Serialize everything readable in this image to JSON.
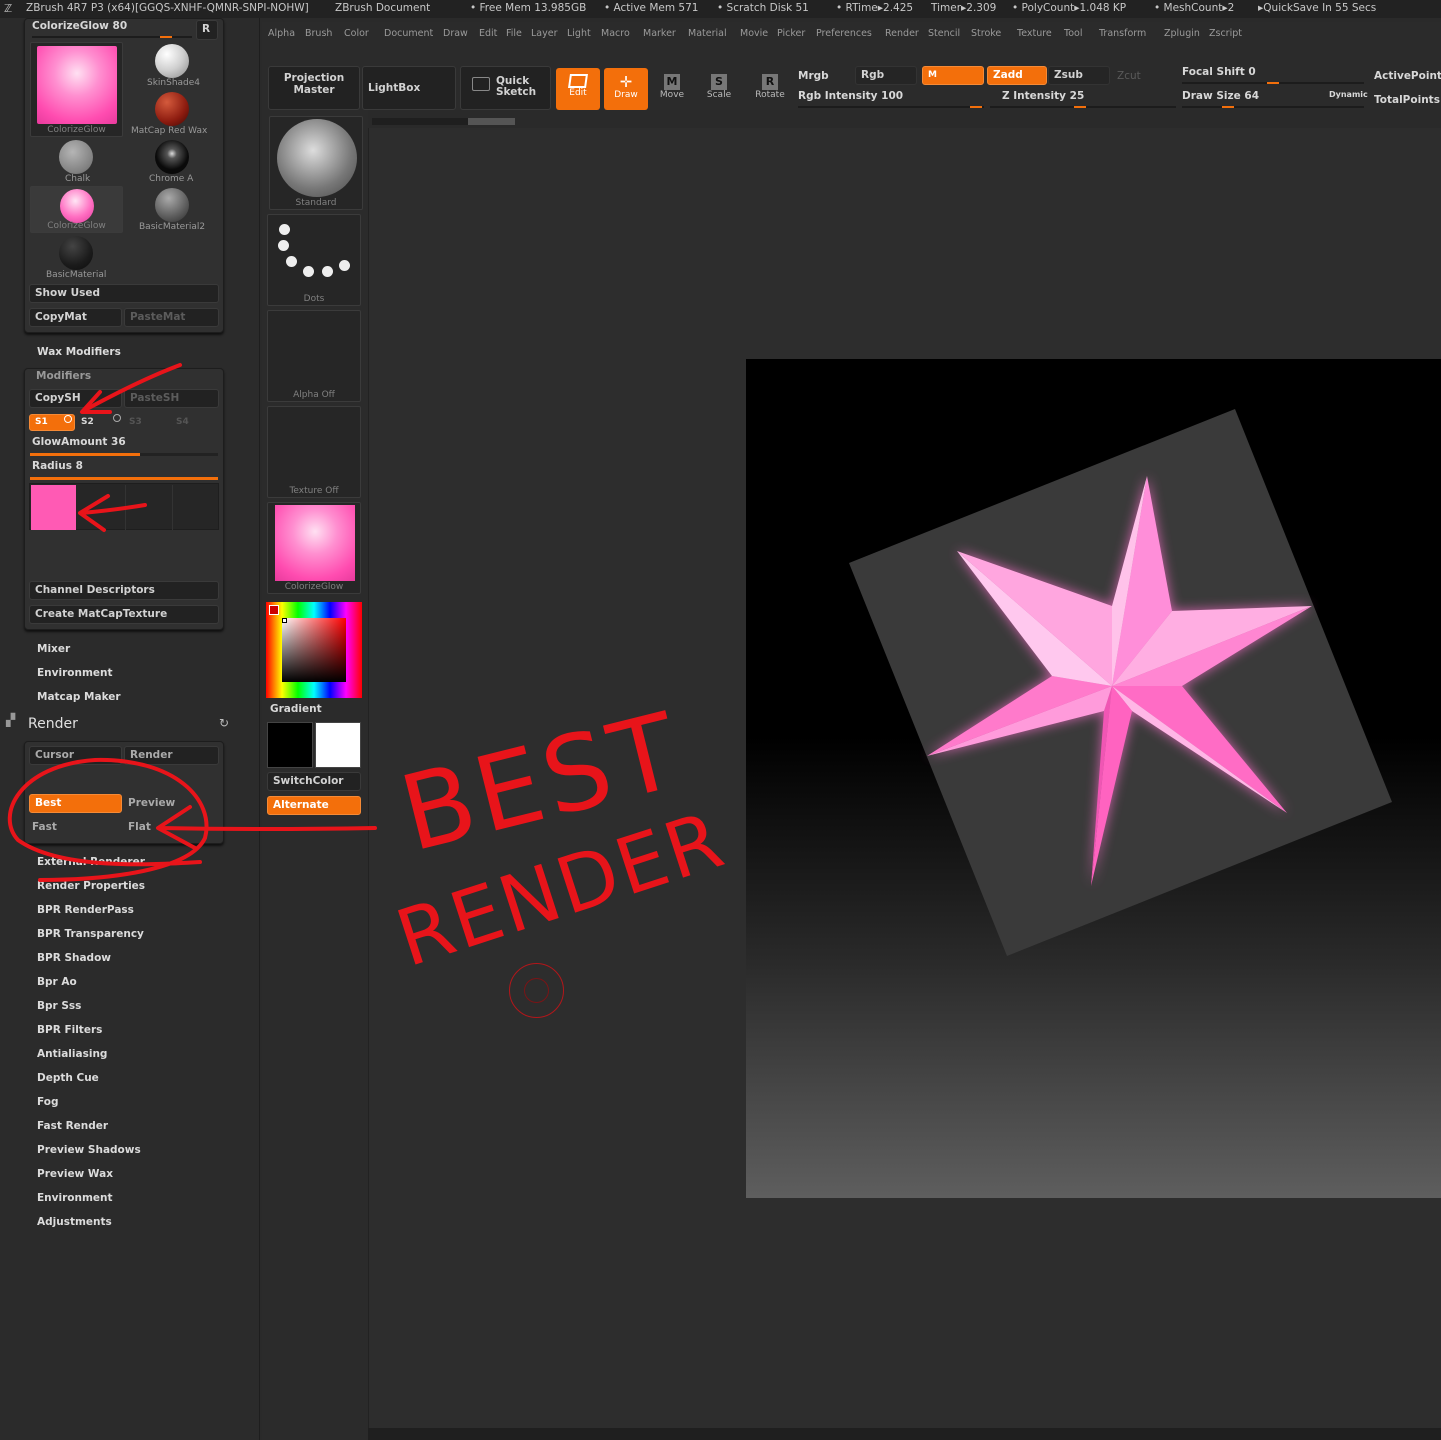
{
  "titlebar": {
    "app": "ZBrush 4R7 P3 (x64)[GGQS-XNHF-QMNR-SNPI-NOHW]",
    "doc": "ZBrush Document",
    "free_mem": "• Free Mem 13.985GB",
    "active_mem": "• Active Mem 571",
    "scratch": "• Scratch Disk 51",
    "rtime": "• RTime▸2.425",
    "timer": "Timer▸2.309",
    "polycount": "• PolyCount▸1.048 KP",
    "meshcount": "• MeshCount▸2",
    "quicksave": "▸QuickSave In 55 Secs"
  },
  "menu": [
    "Alpha",
    "Brush",
    "Color",
    "Document",
    "Draw",
    "Edit",
    "File",
    "Layer",
    "Light",
    "Macro",
    "Marker",
    "Material",
    "Movie",
    "Picker",
    "Preferences",
    "Render",
    "Stencil",
    "Stroke",
    "Texture",
    "Tool",
    "Transform",
    "Zplugin",
    "Zscript"
  ],
  "shelf": {
    "projection_master": "Projection",
    "projection_master2": "Master",
    "lightbox": "LightBox",
    "quick_sketch": "Quick",
    "quick_sketch2": "Sketch",
    "edit": "Edit",
    "draw": "Draw",
    "move": "Move",
    "scale": "Scale",
    "rotate": "Rotate",
    "mrgb": "Mrgb",
    "rgb": "Rgb",
    "m": "M",
    "zadd": "Zadd",
    "zsub": "Zsub",
    "zcut": "Zcut",
    "rgb_intensity": "Rgb Intensity 100",
    "z_intensity": "Z Intensity 25",
    "focal_shift": "Focal Shift 0",
    "draw_size": "Draw Size 64",
    "dynamic": "Dynamic",
    "active_points": "ActivePoints",
    "total_points": "TotalPoints",
    "rgb_intensity_value": 100,
    "z_intensity_value": 25,
    "focal_shift_value": 0,
    "draw_size_value": 64
  },
  "material_panel": {
    "current": "ColorizeGlow 80",
    "r": "R",
    "materials": [
      "ColorizeGlow",
      "SkinShade4",
      "MatCap Red Wax",
      "Chalk",
      "Chrome A",
      "ColorizeGlow",
      "BasicMaterial2",
      "BasicMaterial"
    ],
    "show_used": "Show Used",
    "copymat": "CopyMat",
    "pastemat": "PasteMat"
  },
  "wax": {
    "header": "Wax Modifiers"
  },
  "modifiers": {
    "header": "Modifiers",
    "copysh": "CopySH",
    "pastesh": "PasteSH",
    "s1": "S1",
    "s2": "S2",
    "s3": "S3",
    "s4": "S4",
    "glow_amount": "GlowAmount 36",
    "radius": "Radius 8",
    "glow_value": 36,
    "radius_value": 8,
    "channel_descriptors": "Channel Descriptors",
    "create_matcap": "Create MatCapTexture"
  },
  "left_menu_1": [
    "Mixer",
    "Environment",
    "Matcap Maker"
  ],
  "render": {
    "title": "Render",
    "cursor": "Cursor",
    "render": "Render",
    "best": "Best",
    "preview": "Preview",
    "fast": "Fast",
    "flat": "Flat"
  },
  "render_menu": [
    "External Renderer",
    "Render Properties",
    "BPR RenderPass",
    "BPR Transparency",
    "BPR Shadow",
    "Bpr Ao",
    "Bpr Sss",
    "BPR Filters",
    "Antialiasing",
    "Depth Cue",
    "Fog",
    "Fast Render",
    "Preview Shadows",
    "Preview Wax",
    "Environment",
    "Adjustments"
  ],
  "midcol": {
    "brush": "Standard",
    "stroke": "Dots",
    "alpha": "Alpha Off",
    "texture": "Texture Off",
    "material": "ColorizeGlow",
    "gradient": "Gradient",
    "switchcolor": "SwitchColor",
    "alternate": "Alternate"
  },
  "annotation": {
    "line1": "BEST",
    "line2": "RENDER",
    "color": "#e8141a"
  },
  "colors": {
    "accent": "#f36f0b",
    "pink": "#ff5ab4"
  }
}
